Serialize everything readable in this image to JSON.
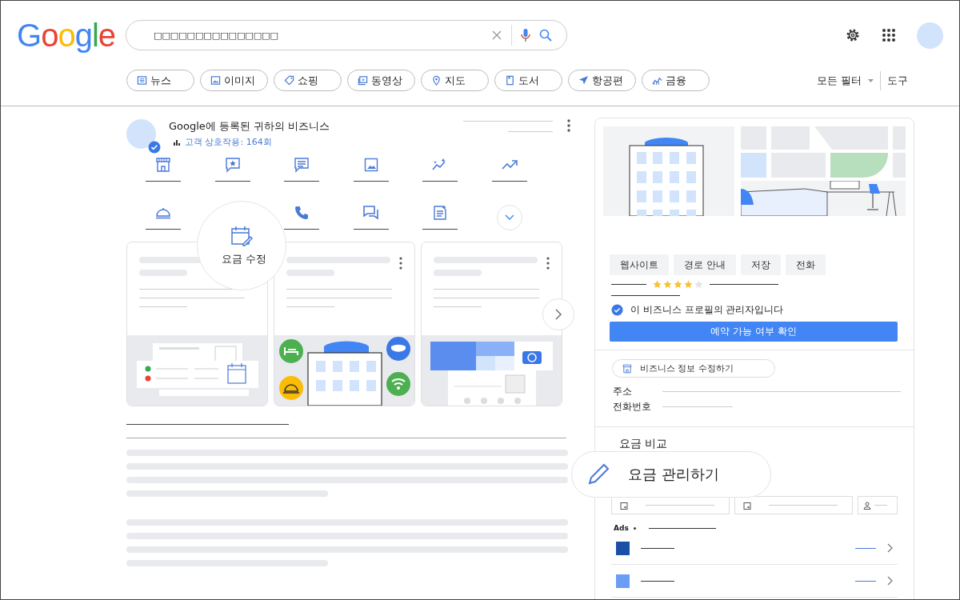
{
  "logo": "Google",
  "search": {
    "value": "□□□□□□□□□□□□□□□"
  },
  "filters": [
    {
      "label": "뉴스",
      "kind": "news"
    },
    {
      "label": "이미지",
      "kind": "images"
    },
    {
      "label": "쇼핑",
      "kind": "shopping"
    },
    {
      "label": "동영상",
      "kind": "videos"
    },
    {
      "label": "지도",
      "kind": "maps"
    },
    {
      "label": "도서",
      "kind": "books"
    },
    {
      "label": "항공편",
      "kind": "flights"
    },
    {
      "label": "금융",
      "kind": "finance"
    }
  ],
  "all_filters": "모든 필터",
  "tools": "도구",
  "business": {
    "title": "Google에 등록된 귀하의 비즈니스",
    "interactions": "고객 상호작용: 164회"
  },
  "callout": "요금 수정",
  "profile_buttons": [
    "웹사이트",
    "경로 안내",
    "저장",
    "전화"
  ],
  "rating": {
    "stars": 4
  },
  "manager_note": "이 비즈니스 프로필의 관리자입니다",
  "book_button": "예약 가능 여부 확인",
  "edit_info": "비즈니스 정보 수정하기",
  "fields": [
    {
      "label": "주소"
    },
    {
      "label": "전화번호"
    }
  ],
  "compare_title": "요금 비교",
  "manage_bubble": "요금 관리하기",
  "ads_label": "Ads",
  "ad_rows": [
    {
      "color": "#1a4fa8"
    },
    {
      "color": "#6a9ef5"
    }
  ]
}
